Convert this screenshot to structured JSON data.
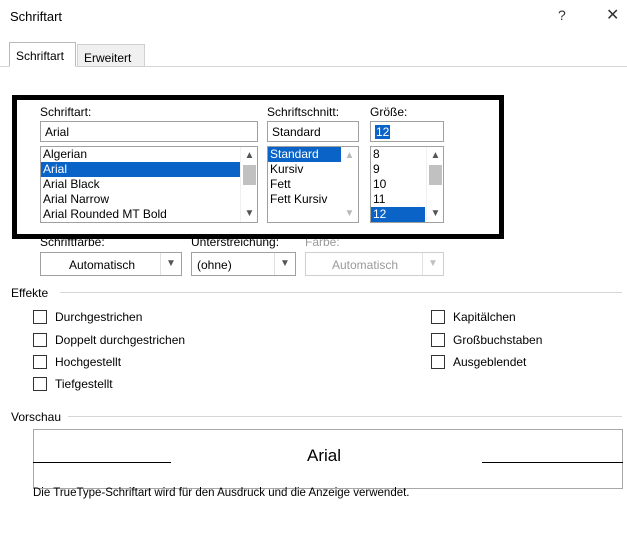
{
  "window": {
    "title": "Schriftart",
    "help_label": "?",
    "close_label": "✕"
  },
  "tabs": [
    {
      "label": "Schriftart",
      "active": true
    },
    {
      "label": "Erweitert",
      "active": false
    }
  ],
  "font": {
    "label": "Schriftart:",
    "value": "Arial",
    "items": [
      "Algerian",
      "Arial",
      "Arial Black",
      "Arial Narrow",
      "Arial Rounded MT Bold"
    ],
    "selected": "Arial"
  },
  "style": {
    "label": "Schriftschnitt:",
    "value": "Standard",
    "items": [
      "Standard",
      "Kursiv",
      "Fett",
      "Fett Kursiv"
    ],
    "selected": "Standard"
  },
  "size": {
    "label": "Größe:",
    "value": "12",
    "items": [
      "8",
      "9",
      "10",
      "11",
      "12"
    ],
    "selected": "12"
  },
  "font_color": {
    "label": "Schriftfarbe:",
    "value": "Automatisch"
  },
  "underline": {
    "label": "Unterstreichung:",
    "value": "(ohne)"
  },
  "underline_color": {
    "label": "Farbe:",
    "value": "Automatisch"
  },
  "effects": {
    "label": "Effekte",
    "left": [
      "Durchgestrichen",
      "Doppelt durchgestrichen",
      "Hochgestellt",
      "Tiefgestellt"
    ],
    "right": [
      "Kapitälchen",
      "Großbuchstaben",
      "Ausgeblendet"
    ]
  },
  "preview": {
    "label": "Vorschau",
    "sample_text": "Arial"
  },
  "footer_text": "Die TrueType-Schriftart wird für den Ausdruck und die Anzeige verwendet.",
  "colors": {
    "selection": "#0a64c8",
    "highlight_border": "#000000"
  }
}
